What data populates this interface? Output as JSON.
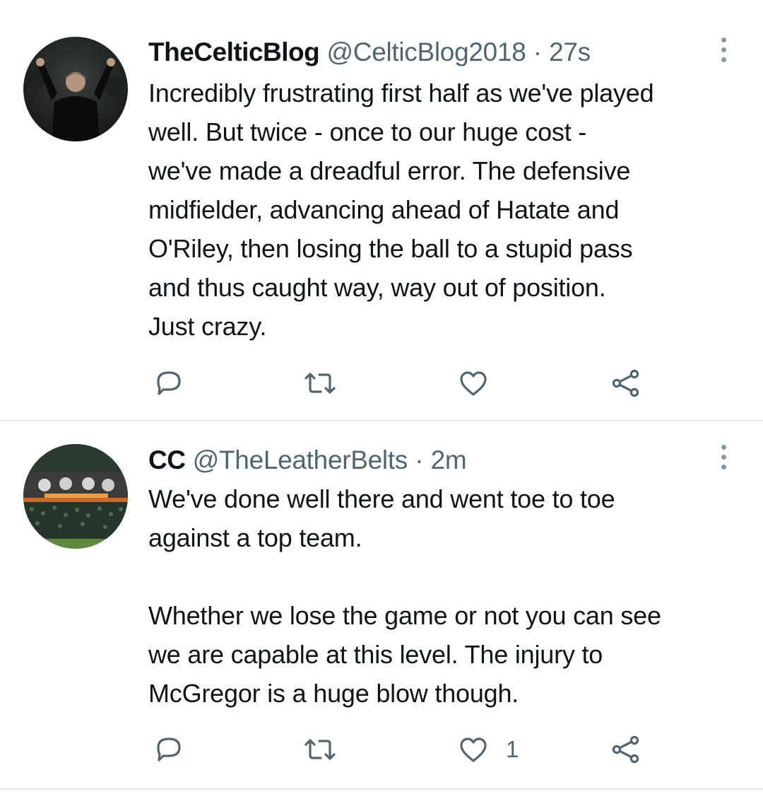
{
  "tweets": [
    {
      "display_name": "TheCelticBlog",
      "handle": "@CelticBlog2018",
      "separator": "·",
      "time": "27s",
      "avatar_icon": "avatar-photo-manager-celebrating",
      "text_lines": [
        "Incredibly frustrating first half as we've played",
        "well. But twice - once to our huge cost -",
        "we've made a dreadful error. The defensive",
        "midfielder, advancing ahead of Hatate and",
        "O'Riley, then losing the ball to a stupid pass",
        "and thus caught way, way out of position.",
        "Just crazy."
      ],
      "like_count": ""
    },
    {
      "display_name": "CC",
      "handle": "@TheLeatherBelts",
      "separator": "·",
      "time": "2m",
      "avatar_icon": "avatar-photo-stadium-banner",
      "text_lines": [
        "We've done well there and went toe to toe",
        "against a top team.",
        "",
        "Whether we lose the game or not you can see",
        "we are capable at this level. The injury to",
        "McGregor is a huge blow though."
      ],
      "like_count": "1"
    }
  ],
  "colors": {
    "text": "#0f1419",
    "secondary": "#536471",
    "icon": "#536471",
    "divider": "#e6ecf0"
  },
  "icons": [
    "reply-icon",
    "retweet-icon",
    "like-icon",
    "share-icon",
    "more-options-icon"
  ]
}
